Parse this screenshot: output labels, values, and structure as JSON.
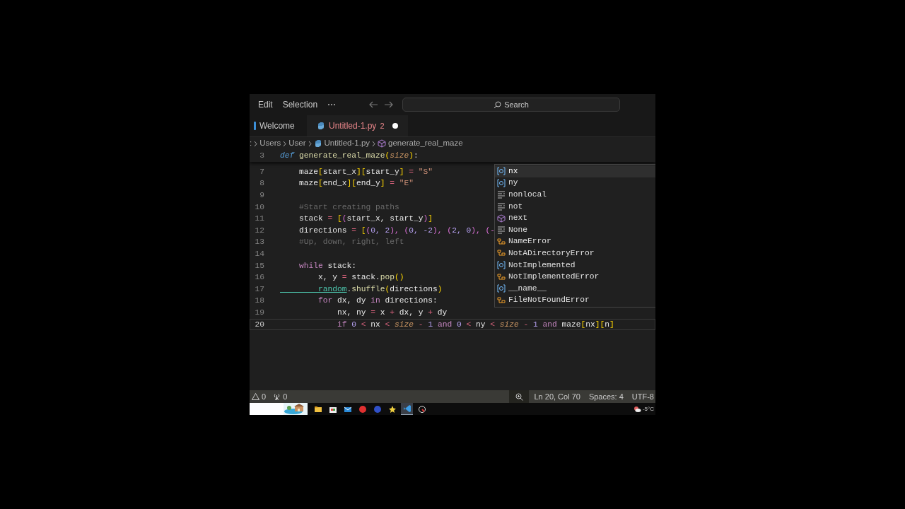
{
  "menu": [
    "Edit",
    "Selection",
    "⋯"
  ],
  "search": {
    "placeholder": "Search"
  },
  "tabs": [
    {
      "label": "Welcome",
      "selected": false,
      "kind": "welcome",
      "modified": false
    },
    {
      "label": "Untitled-1.py",
      "badge": "2",
      "selected": true,
      "kind": "python",
      "modified": true
    }
  ],
  "breadcrumb": [
    {
      "label": ":",
      "kind": "folder"
    },
    {
      "label": "Users",
      "kind": "folder"
    },
    {
      "label": "User",
      "kind": "folder"
    },
    {
      "label": "Untitled-1.py",
      "kind": "python"
    },
    {
      "label": "generate_real_maze",
      "kind": "function"
    }
  ],
  "sticky_line": {
    "number": "3",
    "tokens": [
      {
        "kind": "def",
        "text": "def "
      },
      {
        "kind": "fn",
        "text": "generate_real_maze"
      },
      {
        "kind": "br1",
        "text": "("
      },
      {
        "kind": "param",
        "text": "size"
      },
      {
        "kind": "br1",
        "text": ")"
      },
      {
        "kind": "plain",
        "text": ":"
      }
    ]
  },
  "lines": [
    {
      "number": "7",
      "current": false,
      "tokens": [
        {
          "kind": "var",
          "text": "    maze"
        },
        {
          "kind": "br1",
          "text": "["
        },
        {
          "kind": "var",
          "text": "start_x"
        },
        {
          "kind": "br1",
          "text": "]["
        },
        {
          "kind": "var",
          "text": "start_y"
        },
        {
          "kind": "br1",
          "text": "]"
        },
        {
          "kind": "op",
          "text": " = "
        },
        {
          "kind": "str",
          "text": "\"S\""
        }
      ]
    },
    {
      "number": "8",
      "current": false,
      "tokens": [
        {
          "kind": "var",
          "text": "    maze"
        },
        {
          "kind": "br1",
          "text": "["
        },
        {
          "kind": "var",
          "text": "end_x"
        },
        {
          "kind": "br1",
          "text": "]["
        },
        {
          "kind": "var",
          "text": "end_y"
        },
        {
          "kind": "br1",
          "text": "]"
        },
        {
          "kind": "op",
          "text": " = "
        },
        {
          "kind": "str",
          "text": "\"E\""
        }
      ]
    },
    {
      "number": "9",
      "current": false
    },
    {
      "number": "10",
      "current": false,
      "tokens": [
        {
          "kind": "com",
          "text": "    #Start creating paths"
        }
      ]
    },
    {
      "number": "11",
      "current": false,
      "tokens": [
        {
          "kind": "var",
          "text": "    stack"
        },
        {
          "kind": "op",
          "text": " = "
        },
        {
          "kind": "br1",
          "text": "["
        },
        {
          "kind": "br2",
          "text": "("
        },
        {
          "kind": "var",
          "text": "start_x, start_y"
        },
        {
          "kind": "br2",
          "text": ")"
        },
        {
          "kind": "br1",
          "text": "]"
        }
      ]
    },
    {
      "number": "12",
      "current": false,
      "tokens": [
        {
          "kind": "var",
          "text": "    directions"
        },
        {
          "kind": "op",
          "text": " = "
        },
        {
          "kind": "br1",
          "text": "["
        },
        {
          "kind": "br2",
          "text": "("
        },
        {
          "kind": "num",
          "text": "0, 2"
        },
        {
          "kind": "br2",
          "text": "), ("
        },
        {
          "kind": "num",
          "text": "0, -2"
        },
        {
          "kind": "br2",
          "text": "), ("
        },
        {
          "kind": "num",
          "text": "2, 0"
        },
        {
          "kind": "br2",
          "text": "), (-"
        }
      ]
    },
    {
      "number": "13",
      "current": false,
      "tokens": [
        {
          "kind": "com",
          "text": "    #Up, down, right, left"
        }
      ]
    },
    {
      "number": "14",
      "current": false
    },
    {
      "number": "15",
      "current": false,
      "tokens": [
        {
          "kind": "kw",
          "text": "    while "
        },
        {
          "kind": "var",
          "text": "stack:"
        }
      ]
    },
    {
      "number": "16",
      "current": false,
      "tokens": [
        {
          "kind": "var",
          "text": "        x, y"
        },
        {
          "kind": "op",
          "text": " = "
        },
        {
          "kind": "var",
          "text": "stack."
        },
        {
          "kind": "fn",
          "text": "pop"
        },
        {
          "kind": "br1",
          "text": "()"
        }
      ]
    },
    {
      "number": "17",
      "current": false,
      "tokens": [
        {
          "kind": "mod",
          "text": "        random"
        },
        {
          "kind": "plain",
          "text": "."
        },
        {
          "kind": "fn",
          "text": "shuffle"
        },
        {
          "kind": "br1",
          "text": "("
        },
        {
          "kind": "var",
          "text": "directions"
        },
        {
          "kind": "br1",
          "text": ")"
        }
      ]
    },
    {
      "number": "18",
      "current": false,
      "tokens": [
        {
          "kind": "kw",
          "text": "        for "
        },
        {
          "kind": "var",
          "text": "dx, dy "
        },
        {
          "kind": "kw",
          "text": "in "
        },
        {
          "kind": "var",
          "text": "directions:"
        }
      ]
    },
    {
      "number": "19",
      "current": false,
      "tokens": [
        {
          "kind": "var",
          "text": "            nx, ny"
        },
        {
          "kind": "op",
          "text": " = "
        },
        {
          "kind": "var",
          "text": "x"
        },
        {
          "kind": "op",
          "text": " + "
        },
        {
          "kind": "var",
          "text": "dx, y"
        },
        {
          "kind": "op",
          "text": " + "
        },
        {
          "kind": "var",
          "text": "dy"
        }
      ]
    },
    {
      "number": "20",
      "current": true,
      "tokens": [
        {
          "kind": "kw",
          "text": "            if "
        },
        {
          "kind": "num",
          "text": "0"
        },
        {
          "kind": "op",
          "text": " < "
        },
        {
          "kind": "var",
          "text": "nx"
        },
        {
          "kind": "op",
          "text": " < "
        },
        {
          "kind": "param",
          "text": "size"
        },
        {
          "kind": "op",
          "text": " - "
        },
        {
          "kind": "num",
          "text": "1 "
        },
        {
          "kind": "kw",
          "text": "and "
        },
        {
          "kind": "num",
          "text": "0"
        },
        {
          "kind": "op",
          "text": " < "
        },
        {
          "kind": "var",
          "text": "ny"
        },
        {
          "kind": "op",
          "text": " < "
        },
        {
          "kind": "param",
          "text": "size"
        },
        {
          "kind": "op",
          "text": " - "
        },
        {
          "kind": "num",
          "text": "1 "
        },
        {
          "kind": "kw",
          "text": "and "
        },
        {
          "kind": "var",
          "text": "maze"
        },
        {
          "kind": "br1",
          "text": "["
        },
        {
          "kind": "var",
          "text": "nx"
        },
        {
          "kind": "br1",
          "text": "]["
        },
        {
          "kind": "var",
          "text": "n"
        },
        {
          "kind": "br1",
          "text": "]"
        }
      ]
    }
  ],
  "suggestions": [
    {
      "label": "nx",
      "kind": "variable",
      "selected": true
    },
    {
      "label": "ny",
      "kind": "variable",
      "selected": false
    },
    {
      "label": "nonlocal",
      "kind": "keyword",
      "selected": false
    },
    {
      "label": "not",
      "kind": "keyword",
      "selected": false
    },
    {
      "label": "next",
      "kind": "function",
      "selected": false
    },
    {
      "label": "None",
      "kind": "keyword",
      "selected": false
    },
    {
      "label": "NameError",
      "kind": "class",
      "selected": false
    },
    {
      "label": "NotADirectoryError",
      "kind": "class",
      "selected": false
    },
    {
      "label": "NotImplemented",
      "kind": "variable",
      "selected": false
    },
    {
      "label": "NotImplementedError",
      "kind": "class",
      "selected": false
    },
    {
      "label": "__name__",
      "kind": "variable",
      "selected": false
    },
    {
      "label": "FileNotFoundError",
      "kind": "class",
      "selected": false
    }
  ],
  "status_bar": {
    "warnings": "0",
    "ports": "0",
    "position": "Ln 20, Col 70",
    "spaces": "Spaces: 4",
    "encoding": "UTF-8"
  },
  "taskbar": {
    "apps": [
      {
        "kind": "folder",
        "active": false
      },
      {
        "kind": "store",
        "active": false
      },
      {
        "kind": "mail",
        "active": false
      },
      {
        "kind": "red-circle",
        "active": false
      },
      {
        "kind": "blue-circle",
        "active": false
      },
      {
        "kind": "star",
        "active": false
      },
      {
        "kind": "editor",
        "active": true
      },
      {
        "kind": "gauge",
        "active": false
      }
    ],
    "weather": "-5°C"
  }
}
